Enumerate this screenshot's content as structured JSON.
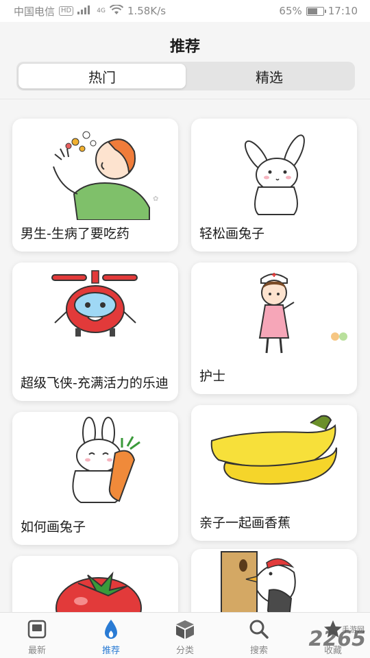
{
  "status_bar": {
    "carrier": "中国电信",
    "hd_badge": "HD",
    "network_type": "4G",
    "speed": "1.58K/s",
    "battery_percent": "65%",
    "battery_level": 0.65,
    "time": "17:10"
  },
  "header": {
    "title": "推荐",
    "tabs": [
      {
        "label": "热门",
        "active": true
      },
      {
        "label": "精选",
        "active": false
      }
    ]
  },
  "cards": [
    {
      "title": "男生-生病了要吃药",
      "icon": "sick-boy-taking-pills-drawing"
    },
    {
      "title": "轻松画兔子",
      "icon": "rabbit-drawing"
    },
    {
      "title": "超级飞侠-充满活力的乐迪",
      "icon": "super-wings-jett-plane-drawing"
    },
    {
      "title": "护士",
      "icon": "nurse-drawing"
    },
    {
      "title": "如何画兔子",
      "icon": "rabbit-with-carrot-drawing"
    },
    {
      "title": "亲子一起画香蕉",
      "icon": "banana-bunch-drawing"
    },
    {
      "title": "",
      "icon": "tomato-drawing"
    },
    {
      "title": "",
      "icon": "woodpecker-drawing"
    }
  ],
  "tab_bar": [
    {
      "label": "最新",
      "icon": "book-icon",
      "active": false
    },
    {
      "label": "推荐",
      "icon": "flame-icon",
      "active": true
    },
    {
      "label": "分类",
      "icon": "box-icon",
      "active": false
    },
    {
      "label": "搜索",
      "icon": "search-icon",
      "active": false
    },
    {
      "label": "收藏",
      "icon": "star-icon",
      "active": false
    }
  ],
  "watermark": {
    "text": "2265",
    "subtext": "手游网"
  },
  "colors": {
    "accent": "#2a7bd4",
    "background": "#f5f5f5",
    "card": "#ffffff"
  }
}
